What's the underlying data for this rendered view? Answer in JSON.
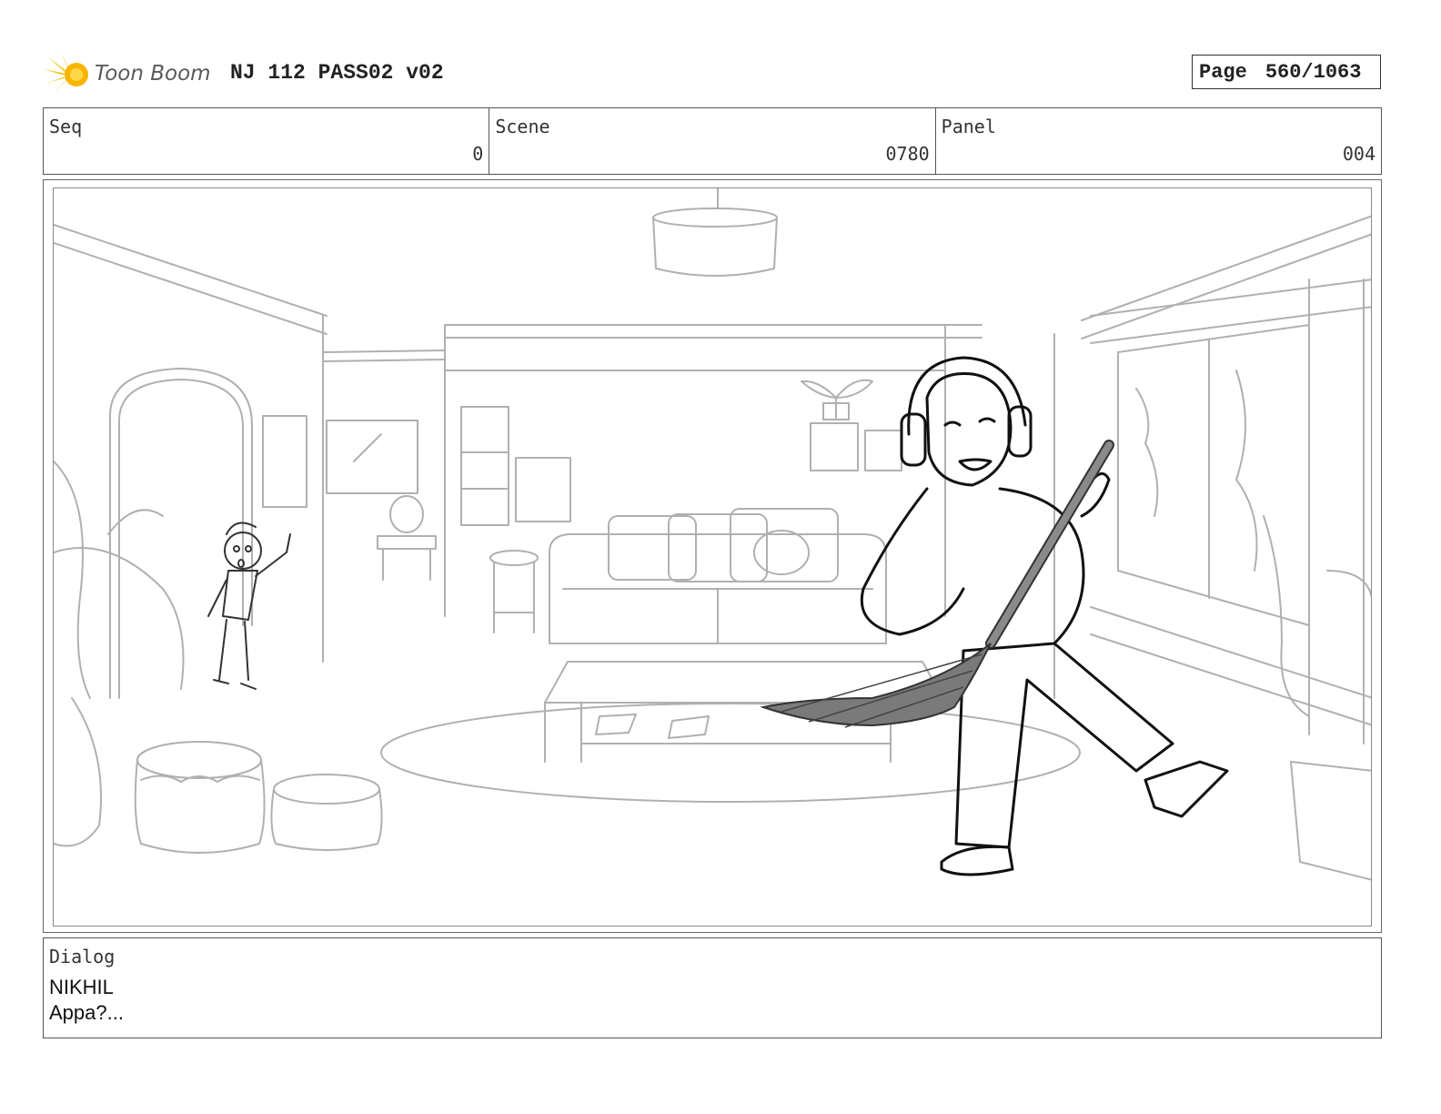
{
  "header": {
    "logo_text": "Toon Boom",
    "title": "NJ 112 PASS02 v02",
    "page_label": "Page",
    "page_value": "560/1063"
  },
  "info": {
    "seq_label": "Seq",
    "seq_value": "0",
    "scene_label": "Scene",
    "scene_value": "0780",
    "panel_label": "Panel",
    "panel_value": "004"
  },
  "dialog": {
    "label": "Dialog",
    "speaker": "NIKHIL",
    "line": "Appa?..."
  },
  "colors": {
    "logo_yellow": "#f5c400",
    "sketch_grey": "#b0b0b0",
    "ink": "#1a1a1a"
  }
}
